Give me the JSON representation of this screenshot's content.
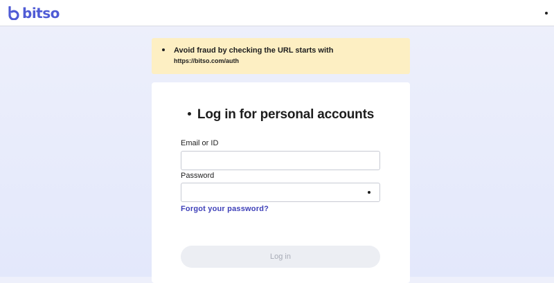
{
  "header": {
    "logo_text": "bitso",
    "logo_icon": "bitso-logo-icon",
    "menu_icon": "menu-dot-icon",
    "brand_color": "#4f5bd5"
  },
  "banner": {
    "line1": "Avoid fraud by checking the URL starts with",
    "line2": "https://bitso.com/auth"
  },
  "login": {
    "title": "Log in for personal accounts",
    "email_label": "Email or ID",
    "email_value": "",
    "password_label": "Password",
    "password_value": "",
    "show_password_icon": "show-password-icon",
    "forgot_link": "Forgot your password?",
    "login_button": "Log in",
    "link_color": "#3d3fb8"
  }
}
